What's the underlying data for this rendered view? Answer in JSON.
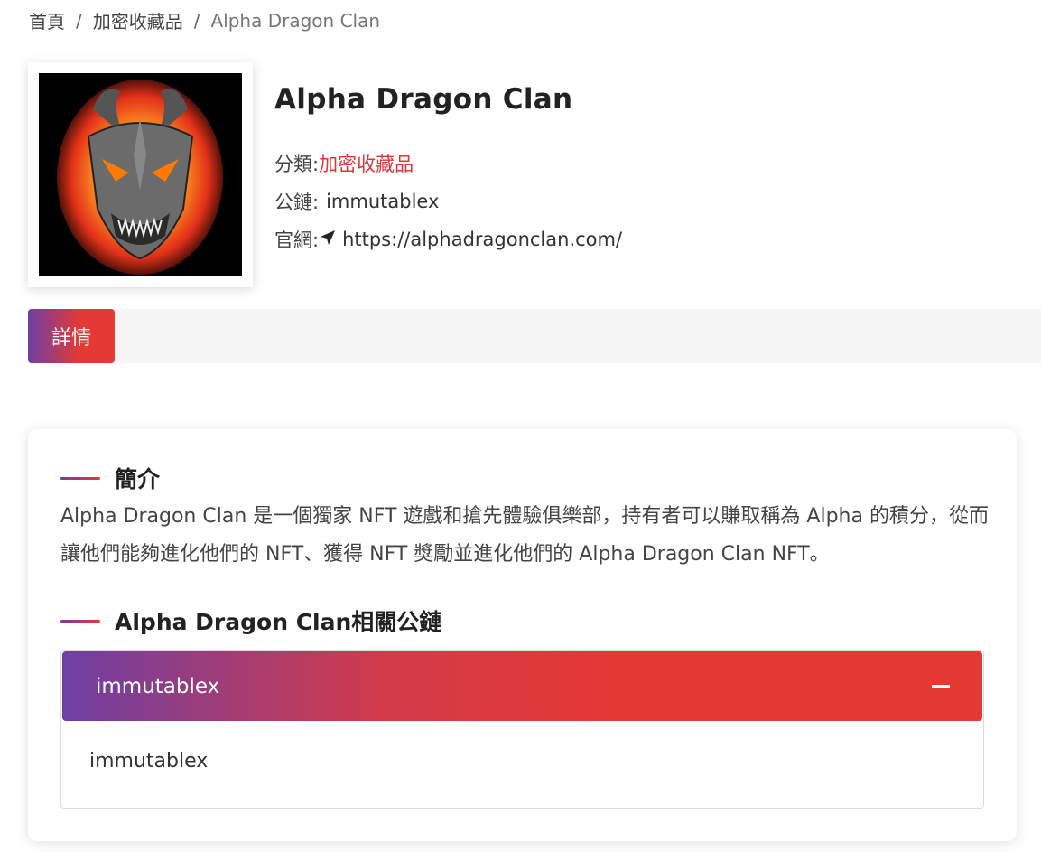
{
  "breadcrumb": {
    "home": "首頁",
    "category": "加密收藏品",
    "current": "Alpha Dragon Clan",
    "separator": "/"
  },
  "project": {
    "name": "Alpha Dragon Clan",
    "category_label": "分類:",
    "category_value": "加密收藏品",
    "chain_label": "公鏈:",
    "chain_value": "immutablex",
    "website_label": "官網:",
    "website_value": "https://alphadragonclan.com/"
  },
  "tabs": {
    "details": "詳情"
  },
  "intro": {
    "title": "簡介",
    "text": "Alpha Dragon Clan 是一個獨家 NFT 遊戲和搶先體驗俱樂部，持有者可以賺取稱為 Alpha 的積分，從而讓他們能夠進化他們的 NFT、獲得 NFT 獎勵並進化他們的 Alpha Dragon Clan NFT。"
  },
  "related_chains": {
    "title": "Alpha Dragon Clan相關公鏈",
    "items": [
      {
        "header": "immutablex",
        "body": "immutablex"
      }
    ]
  },
  "colors": {
    "accent_red": "#e53935",
    "accent_purple": "#6e3fa3"
  }
}
